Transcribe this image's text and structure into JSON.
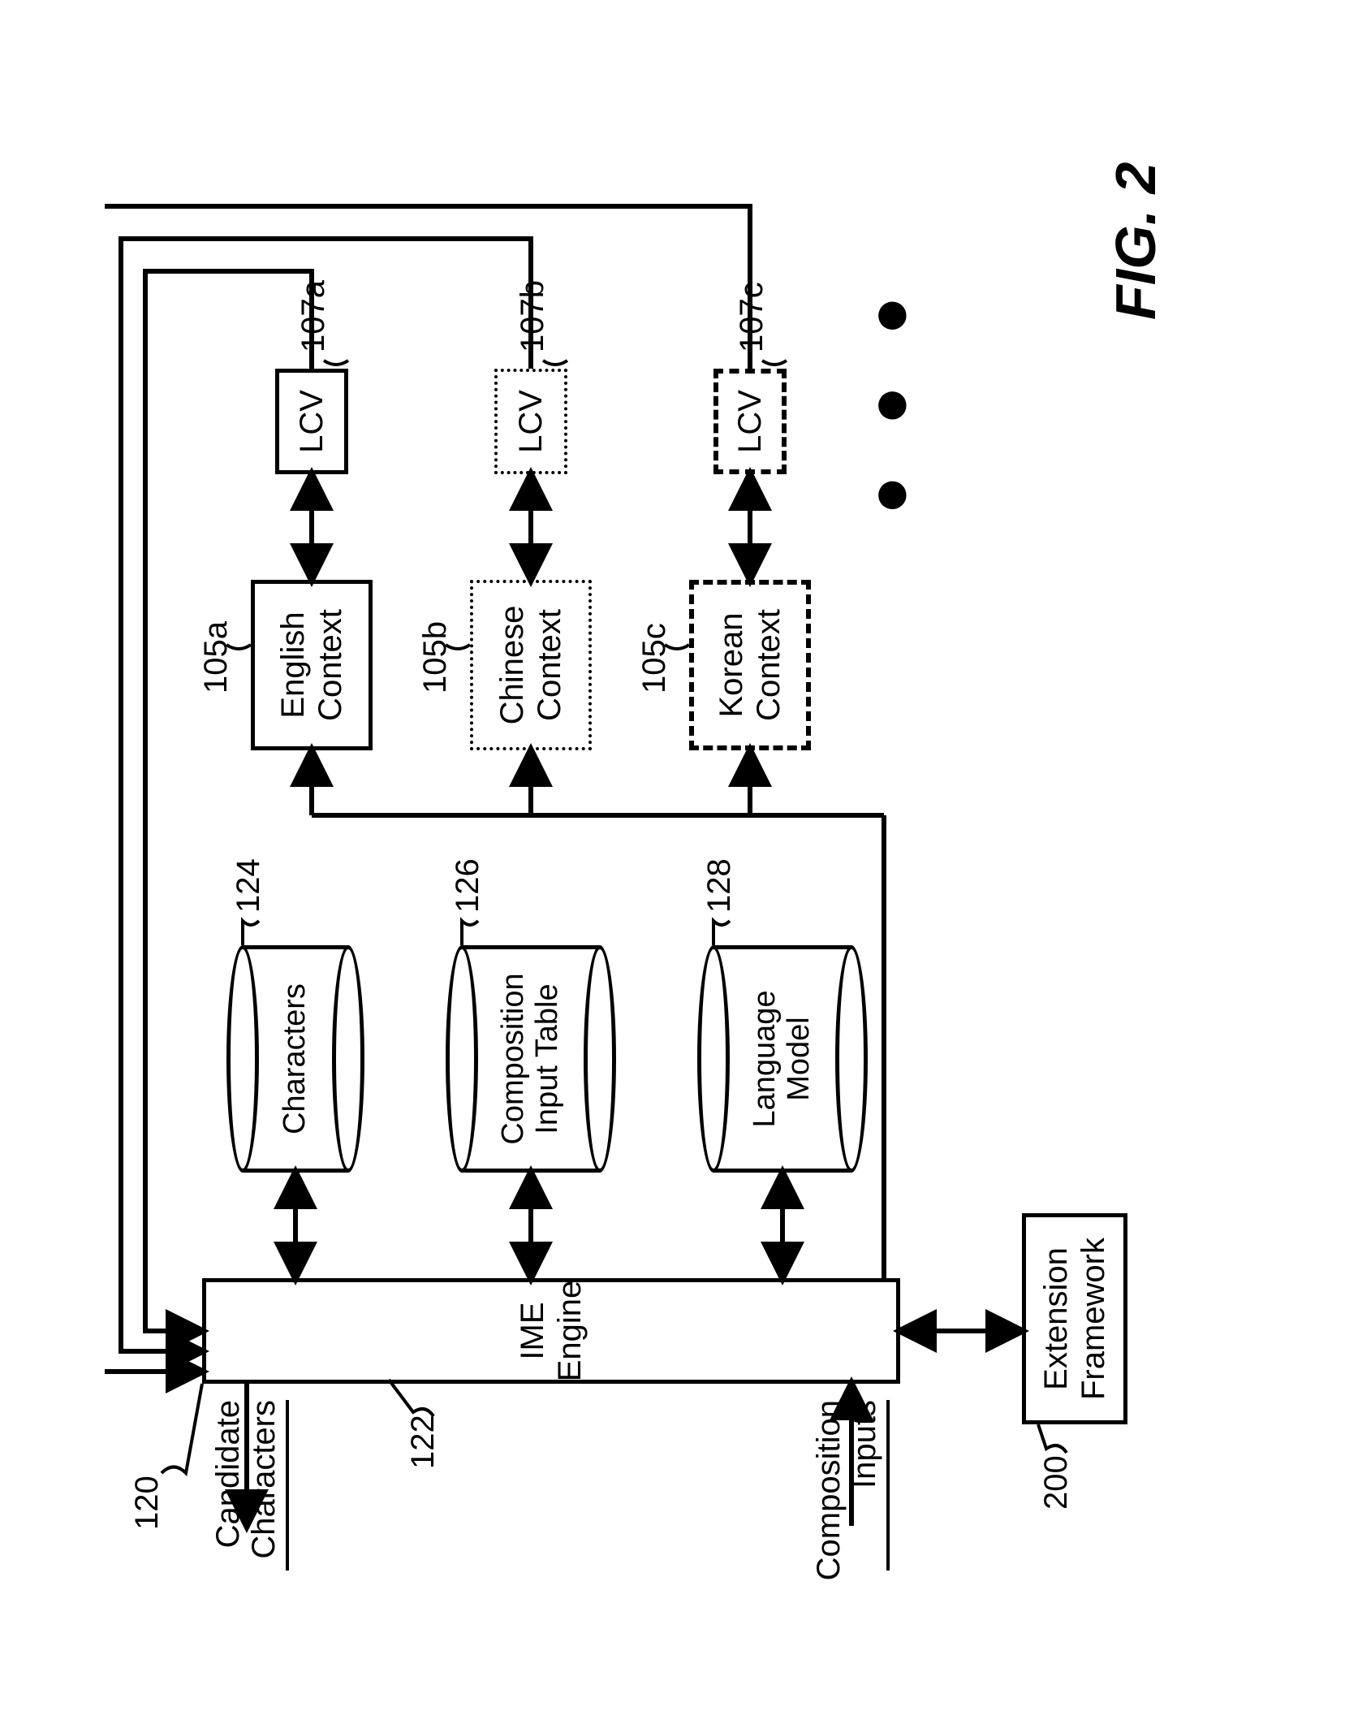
{
  "figure_label": "FIG. 2",
  "refs": {
    "r120": "120",
    "r122": "122",
    "r124": "124",
    "r126": "126",
    "r128": "128",
    "r200": "200",
    "r105a": "105a",
    "r105b": "105b",
    "r105c": "105c",
    "r107a": "107a",
    "r107b": "107b",
    "r107c": "107c"
  },
  "blocks": {
    "ime_engine": "IME\nEngine",
    "extension_framework": "Extension\nFramework",
    "characters_db": "Characters",
    "composition_table_db": "Composition\nInput Table",
    "language_model_db": "Language\nModel",
    "english_context": "English\nContext",
    "chinese_context": "Chinese\nContext",
    "korean_context": "Korean\nContext",
    "lcv": "LCV"
  },
  "io_labels": {
    "candidate_characters": "Candidate\nCharacters",
    "composition_inputs": "Composition\nInputs"
  },
  "ellipsis": "● ● ●"
}
